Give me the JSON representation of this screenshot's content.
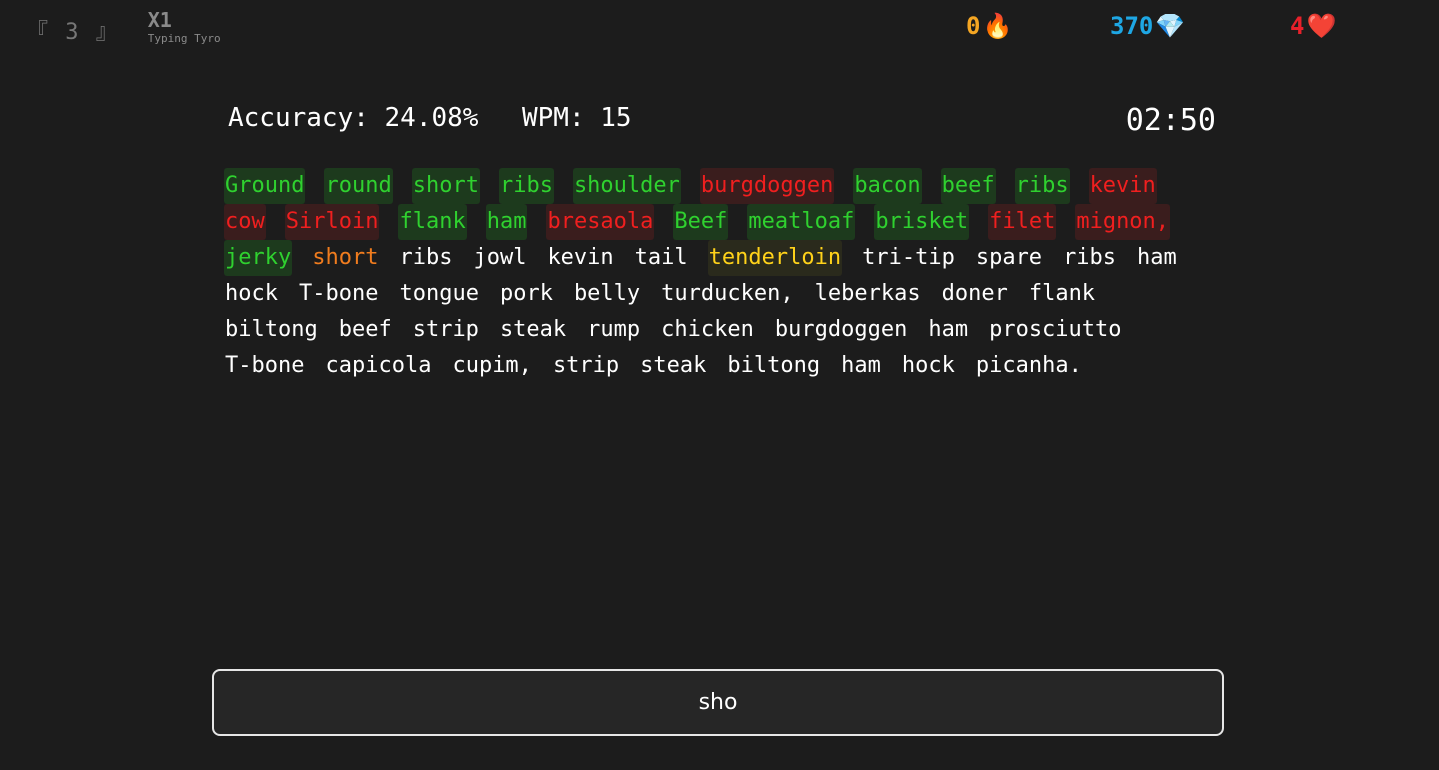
{
  "header": {
    "logo_mark": "『 3 』",
    "level": "X1",
    "rank": "Typing Tyro",
    "streak": "0",
    "streak_icon": "fire-icon",
    "gems": "370",
    "gems_icon": "diamond-icon",
    "lives": "4",
    "lives_icon": "heart-icon"
  },
  "stats": {
    "accuracy": "Accuracy: 24.08%",
    "wpm": "WPM: 15",
    "timer": "02:50"
  },
  "colors": {
    "correct": "#2fd12f",
    "wrong": "#f01f1f",
    "current": "#f07c1e",
    "next": "#ffd21a",
    "pending": "#ffffff"
  },
  "words": [
    {
      "text": "Ground",
      "state": "correct"
    },
    {
      "text": "round",
      "state": "correct"
    },
    {
      "text": "short",
      "state": "correct"
    },
    {
      "text": "ribs",
      "state": "correct"
    },
    {
      "text": "shoulder",
      "state": "correct"
    },
    {
      "text": "burgdoggen",
      "state": "wrong"
    },
    {
      "text": "bacon",
      "state": "correct"
    },
    {
      "text": "beef",
      "state": "correct"
    },
    {
      "text": "ribs",
      "state": "correct"
    },
    {
      "text": "kevin",
      "state": "wrong"
    },
    {
      "text": "cow",
      "state": "wrong"
    },
    {
      "text": "Sirloin",
      "state": "wrong"
    },
    {
      "text": "flank",
      "state": "correct"
    },
    {
      "text": "ham",
      "state": "correct"
    },
    {
      "text": "bresaola",
      "state": "wrong"
    },
    {
      "text": "Beef",
      "state": "correct"
    },
    {
      "text": "meatloaf",
      "state": "correct"
    },
    {
      "text": "brisket",
      "state": "correct"
    },
    {
      "text": "filet",
      "state": "wrong"
    },
    {
      "text": "mignon,",
      "state": "wrong"
    },
    {
      "text": "jerky",
      "state": "correct"
    },
    {
      "text": "short",
      "state": "current"
    },
    {
      "text": "ribs",
      "state": "pending"
    },
    {
      "text": "jowl",
      "state": "pending"
    },
    {
      "text": "kevin",
      "state": "pending"
    },
    {
      "text": "tail",
      "state": "pending"
    },
    {
      "text": "tenderloin",
      "state": "next"
    },
    {
      "text": "tri-tip",
      "state": "pending"
    },
    {
      "text": "spare",
      "state": "pending"
    },
    {
      "text": "ribs",
      "state": "pending"
    },
    {
      "text": "ham",
      "state": "pending"
    },
    {
      "text": "hock",
      "state": "pending"
    },
    {
      "text": "T-bone",
      "state": "pending"
    },
    {
      "text": "tongue",
      "state": "pending"
    },
    {
      "text": "pork",
      "state": "pending"
    },
    {
      "text": "belly",
      "state": "pending"
    },
    {
      "text": "turducken,",
      "state": "pending"
    },
    {
      "text": "leberkas",
      "state": "pending"
    },
    {
      "text": "doner",
      "state": "pending"
    },
    {
      "text": "flank",
      "state": "pending"
    },
    {
      "text": "biltong",
      "state": "pending"
    },
    {
      "text": "beef",
      "state": "pending"
    },
    {
      "text": "strip",
      "state": "pending"
    },
    {
      "text": "steak",
      "state": "pending"
    },
    {
      "text": "rump",
      "state": "pending"
    },
    {
      "text": "chicken",
      "state": "pending"
    },
    {
      "text": "burgdoggen",
      "state": "pending"
    },
    {
      "text": "ham",
      "state": "pending"
    },
    {
      "text": "prosciutto",
      "state": "pending"
    },
    {
      "text": "T-bone",
      "state": "pending"
    },
    {
      "text": "capicola",
      "state": "pending"
    },
    {
      "text": "cupim,",
      "state": "pending"
    },
    {
      "text": "strip",
      "state": "pending"
    },
    {
      "text": "steak",
      "state": "pending"
    },
    {
      "text": "biltong",
      "state": "pending"
    },
    {
      "text": "ham",
      "state": "pending"
    },
    {
      "text": "hock",
      "state": "pending"
    },
    {
      "text": "picanha.",
      "state": "pending"
    }
  ],
  "input": {
    "value": "sho"
  }
}
